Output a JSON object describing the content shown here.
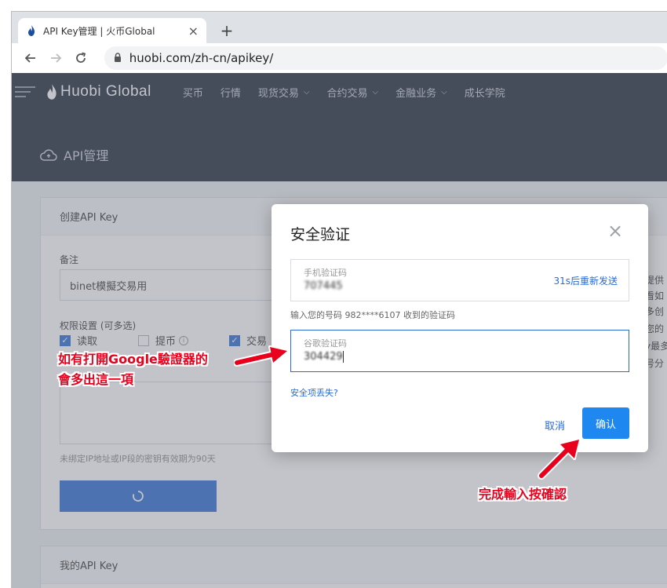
{
  "browser": {
    "tab_title": "API Key管理 | 火币Global",
    "tab_close": "×",
    "new_tab": "+",
    "url": "huobi.com/zh-cn/apikey/"
  },
  "nav": {
    "brand": "Huobi Global",
    "items": [
      {
        "label": "买币",
        "dropdown": false
      },
      {
        "label": "行情",
        "dropdown": false
      },
      {
        "label": "现货交易",
        "dropdown": true
      },
      {
        "label": "合约交易",
        "dropdown": true
      },
      {
        "label": "金融业务",
        "dropdown": true
      },
      {
        "label": "成长学院",
        "dropdown": false
      }
    ]
  },
  "hero": {
    "title": "API管理"
  },
  "create_panel": {
    "title": "创建API Key",
    "note_label": "备注",
    "note_value": "binet模擬交易用",
    "perm_label": "权限设置 (可多选)",
    "perms": [
      {
        "label": "读取",
        "checked": true
      },
      {
        "label": "提币",
        "checked": false
      },
      {
        "label": "交易",
        "checked": true
      }
    ],
    "hint": "未绑定IP地址或IP段的密钥有效期为90天",
    "right_text": [
      "提供",
      "看如",
      "多创",
      "您的",
      "y最多",
      "号分"
    ]
  },
  "my_panel": {
    "title": "我的API Key"
  },
  "modal": {
    "title": "安全验证",
    "close": "×",
    "sms_label": "手机验证码",
    "sms_value": "707445",
    "resend": "31s后重新发送",
    "sms_hint": "输入您的号码 982****6107 收到的验证码",
    "ga_label": "谷歌验证码",
    "ga_value": "304429",
    "lost_link": "安全项丢失?",
    "cancel": "取消",
    "confirm": "确认"
  },
  "annotations": {
    "ga_note_line1": "如有打開Google驗證器的",
    "ga_note_line2": "會多出這一項",
    "confirm_note": "完成輸入按確認"
  },
  "colors": {
    "accent": "#2a6bd6",
    "nav_bg": "#1d2636",
    "annotation": "#e8001c"
  }
}
